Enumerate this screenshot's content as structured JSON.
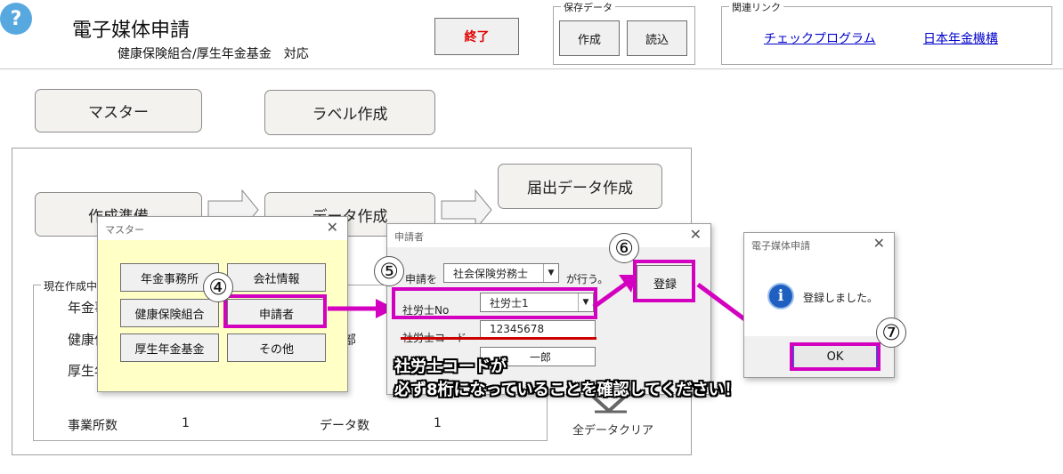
{
  "header": {
    "title": "電子媒体申請",
    "subtitle": "健康保険組合/厚生年金基金　対応",
    "exit_label": "終了",
    "save_group": "保存データ",
    "create_label": "作成",
    "load_label": "読込",
    "links_group": "関連リンク",
    "link_check": "チェックプログラム",
    "link_pension": "日本年金機構"
  },
  "main": {
    "master_label": "マスター",
    "label_create": "ラベル作成",
    "prep_label": "作成準備",
    "data_create": "データ作成",
    "submit_create": "届出データ作成",
    "current_group": "現在作成中",
    "row1": "年金事",
    "row2": "健康保",
    "row3": "厚生年",
    "partial_right": "部",
    "office_count_label": "事業所数",
    "office_count": "1",
    "data_count_label": "データ数",
    "data_count": "1",
    "clear_all": "全データクリア"
  },
  "master_dialog": {
    "title": "マスター",
    "close": "✕",
    "btn_nenkin": "年金事務所",
    "btn_company": "会社情報",
    "btn_kenpo": "健康保険組合",
    "btn_applicant": "申請者",
    "btn_kosei": "厚生年金基金",
    "btn_other": "その他"
  },
  "applicant_dialog": {
    "title": "申請者",
    "close": "✕",
    "apply_prefix": "申請を",
    "apply_select": "社会保険労務士",
    "apply_suffix": "が行う。",
    "sharoushi_no_label": "社労士No",
    "sharoushi_no_value": "社労士1",
    "code_label": "社労士コード",
    "code_value": "12345678",
    "name_value": "一郎",
    "register_label": "登録"
  },
  "confirm_dialog": {
    "title": "電子媒体申請",
    "close": "✕",
    "message": "登録しました。",
    "ok_label": "OK"
  },
  "annotations": {
    "step4": "④",
    "step5": "⑤",
    "step6": "⑥",
    "step7": "⑦",
    "note_line1": "社労士コードが",
    "note_line2": "必ず8桁になっていることを確認してください！"
  },
  "colors": {
    "highlight": "#d400c0",
    "underline": "#cc0000",
    "master_bg": "#ffffc6"
  }
}
